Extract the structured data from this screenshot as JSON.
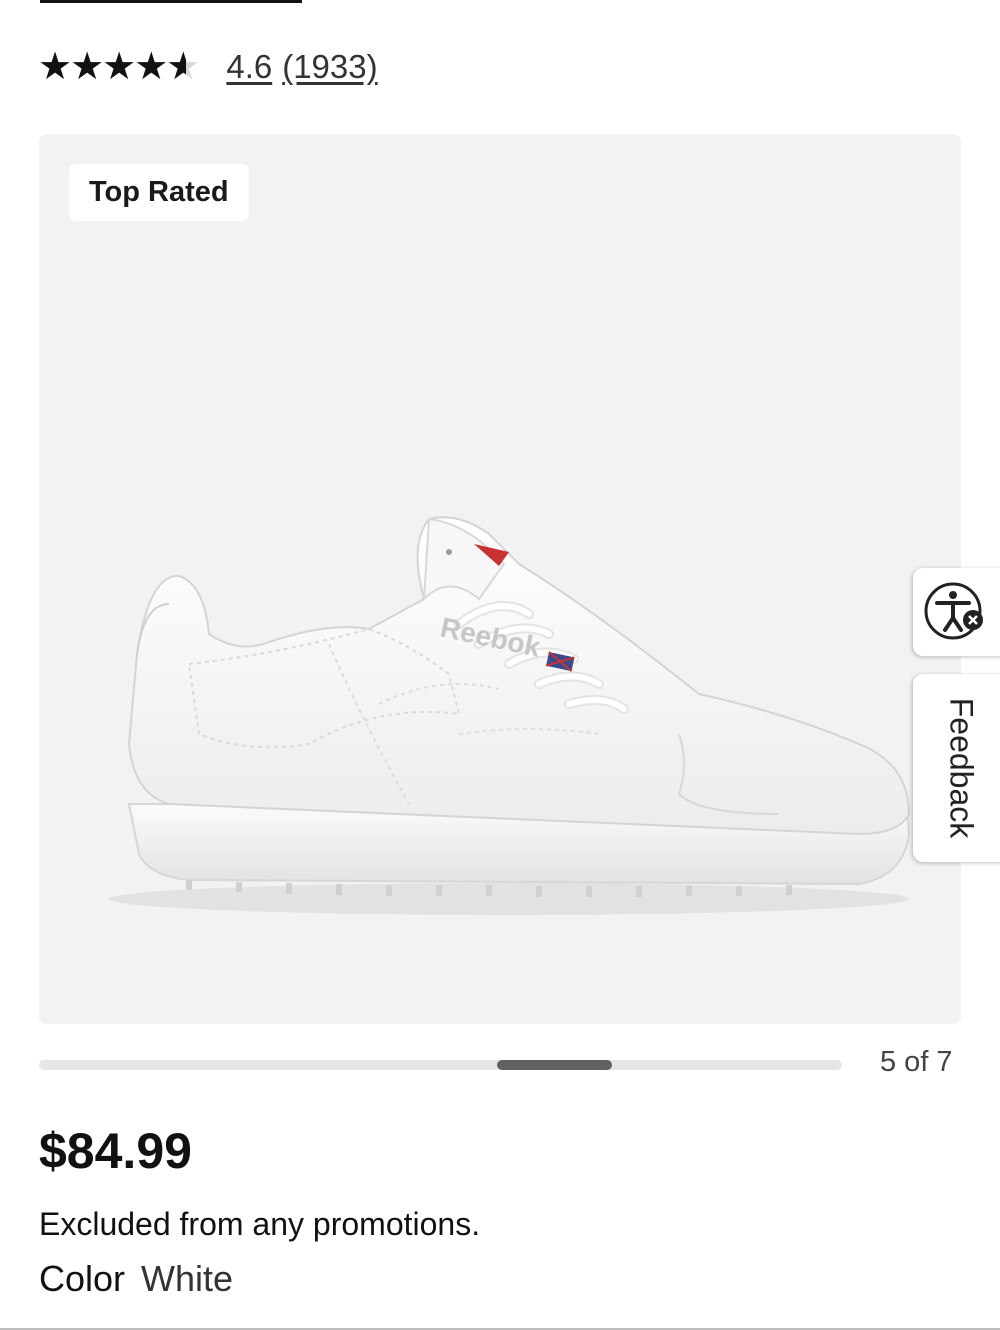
{
  "rating": {
    "stars_shown": "★★★★★",
    "score": "4.6",
    "fill_fraction": 0.92,
    "review_count": "(1933)"
  },
  "gallery": {
    "badge": "Top Rated",
    "shoe_brand_mark": "Reebok",
    "counter": "5 of 7",
    "current": 5,
    "total": 7
  },
  "side_tabs": {
    "accessibility_icon": "accessibility-icon",
    "feedback_label": "Feedback"
  },
  "product": {
    "price": "$84.99",
    "promo_note": "Excluded from any promotions.",
    "color_label": "Color",
    "color_value": "White"
  }
}
